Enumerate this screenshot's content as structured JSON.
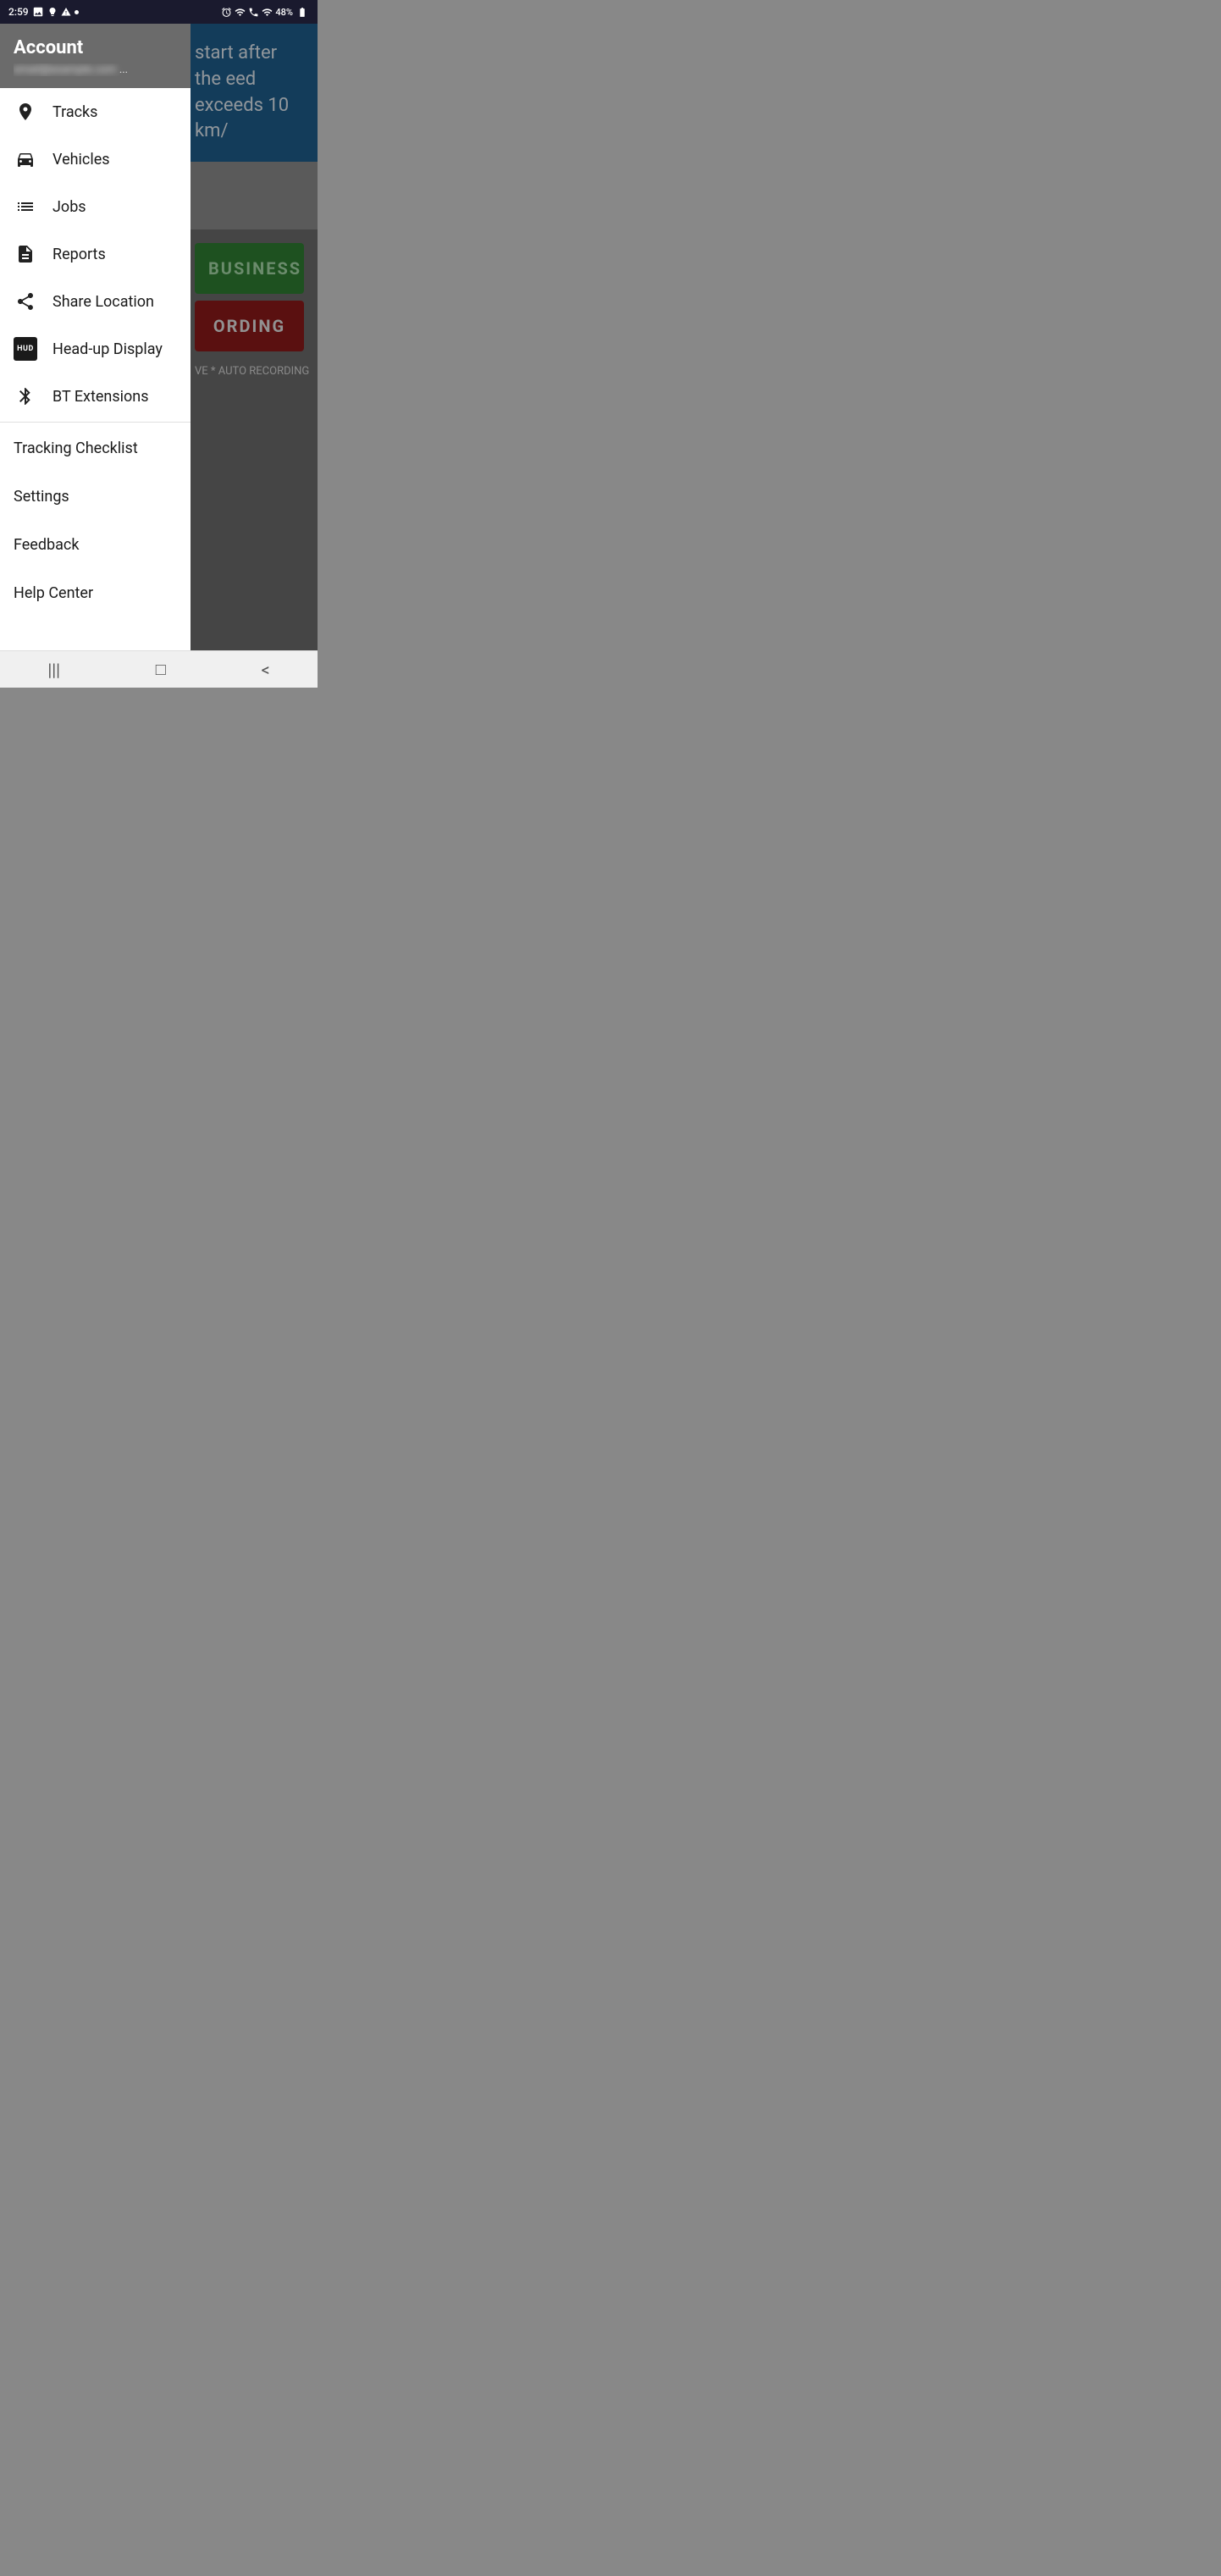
{
  "statusBar": {
    "time": "2:59",
    "battery": "48%",
    "icons": [
      "photo",
      "lightbulb",
      "warning",
      "dot",
      "alarm",
      "wifi",
      "phone",
      "signal",
      "battery"
    ]
  },
  "background": {
    "blueBarText": "start after the eed exceeds 10 km/",
    "greenBtnText": "BUSINESS",
    "redBtnText": "ORDING",
    "autoText": "VE * AUTO RECORDING"
  },
  "drawer": {
    "accountTitle": "Account",
    "accountEmail": "••••••••••••••••••••...",
    "menuItems": [
      {
        "id": "tracks",
        "label": "Tracks",
        "icon": "location-pin"
      },
      {
        "id": "vehicles",
        "label": "Vehicles",
        "icon": "car"
      },
      {
        "id": "jobs",
        "label": "Jobs",
        "icon": "list"
      },
      {
        "id": "reports",
        "label": "Reports",
        "icon": "document"
      },
      {
        "id": "share-location",
        "label": "Share Location",
        "icon": "share"
      },
      {
        "id": "head-up-display",
        "label": "Head-up Display",
        "icon": "hud"
      },
      {
        "id": "bt-extensions",
        "label": "BT Extensions",
        "icon": "bluetooth"
      }
    ],
    "textMenuItems": [
      {
        "id": "tracking-checklist",
        "label": "Tracking Checklist"
      },
      {
        "id": "settings",
        "label": "Settings"
      },
      {
        "id": "feedback",
        "label": "Feedback"
      },
      {
        "id": "help-center",
        "label": "Help Center"
      }
    ]
  },
  "bottomNav": {
    "recentBtn": "|||",
    "homeBtn": "□",
    "backBtn": "<"
  }
}
